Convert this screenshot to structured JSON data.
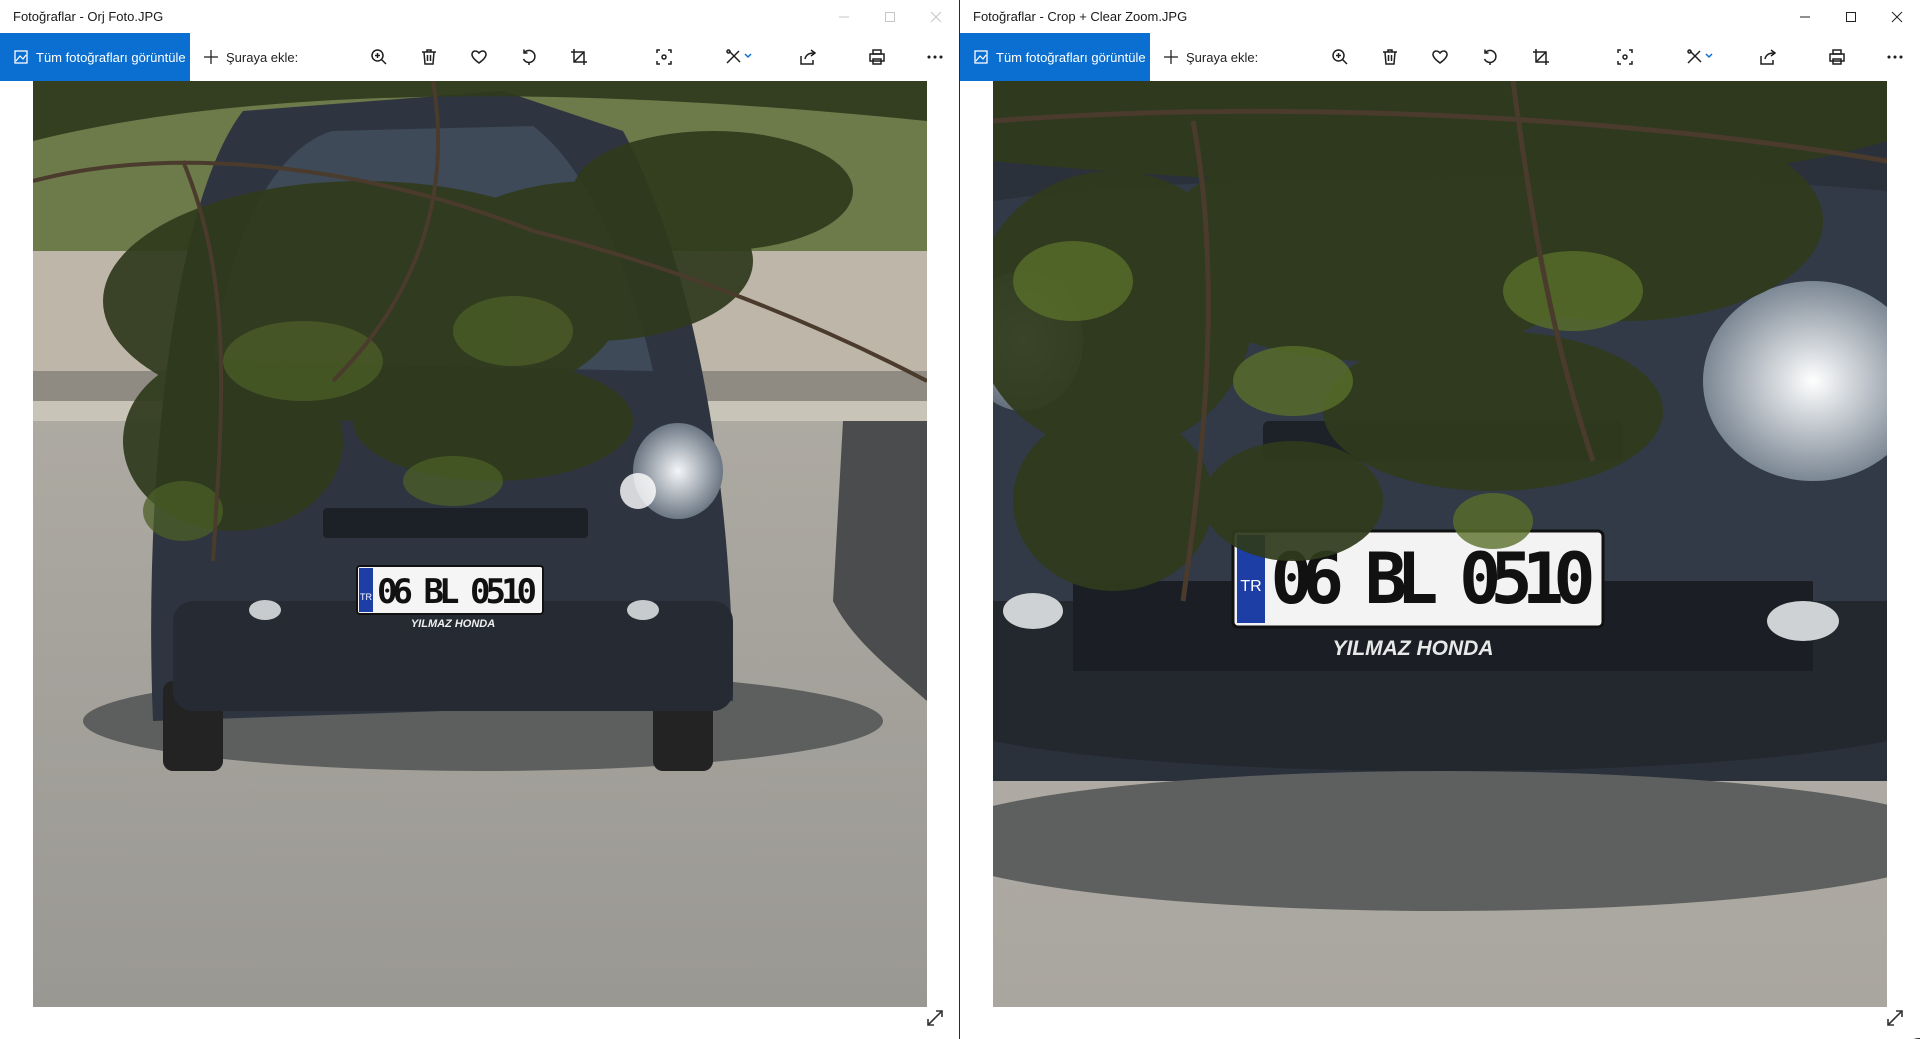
{
  "left_window": {
    "title": "Fotoğraflar - Orj Foto.JPG",
    "view_all_label": "Tüm fotoğrafları görüntüle",
    "add_to_label": "Şuraya ekle:",
    "plate_main": "06 BL 0510",
    "plate_country": "TR",
    "plate_dealer": "YILMAZ HONDA"
  },
  "right_window": {
    "title": "Fotoğraflar - Crop + Clear Zoom.JPG",
    "view_all_label": "Tüm fotoğrafları görüntüle",
    "add_to_label": "Şuraya ekle:",
    "plate_main": "06 BL 0510",
    "plate_country": "TR",
    "plate_dealer": "YILMAZ HONDA"
  },
  "toolbar_icons": [
    "zoom-in-icon",
    "delete-icon",
    "favorite-icon",
    "rotate-icon",
    "crop-icon",
    "enhance-icon",
    "edit-icon",
    "share-icon",
    "print-icon",
    "more-icon"
  ],
  "colors": {
    "accent": "#0a6fd0",
    "car_body": "#2e3540",
    "foliage": "#2f3a1c"
  }
}
